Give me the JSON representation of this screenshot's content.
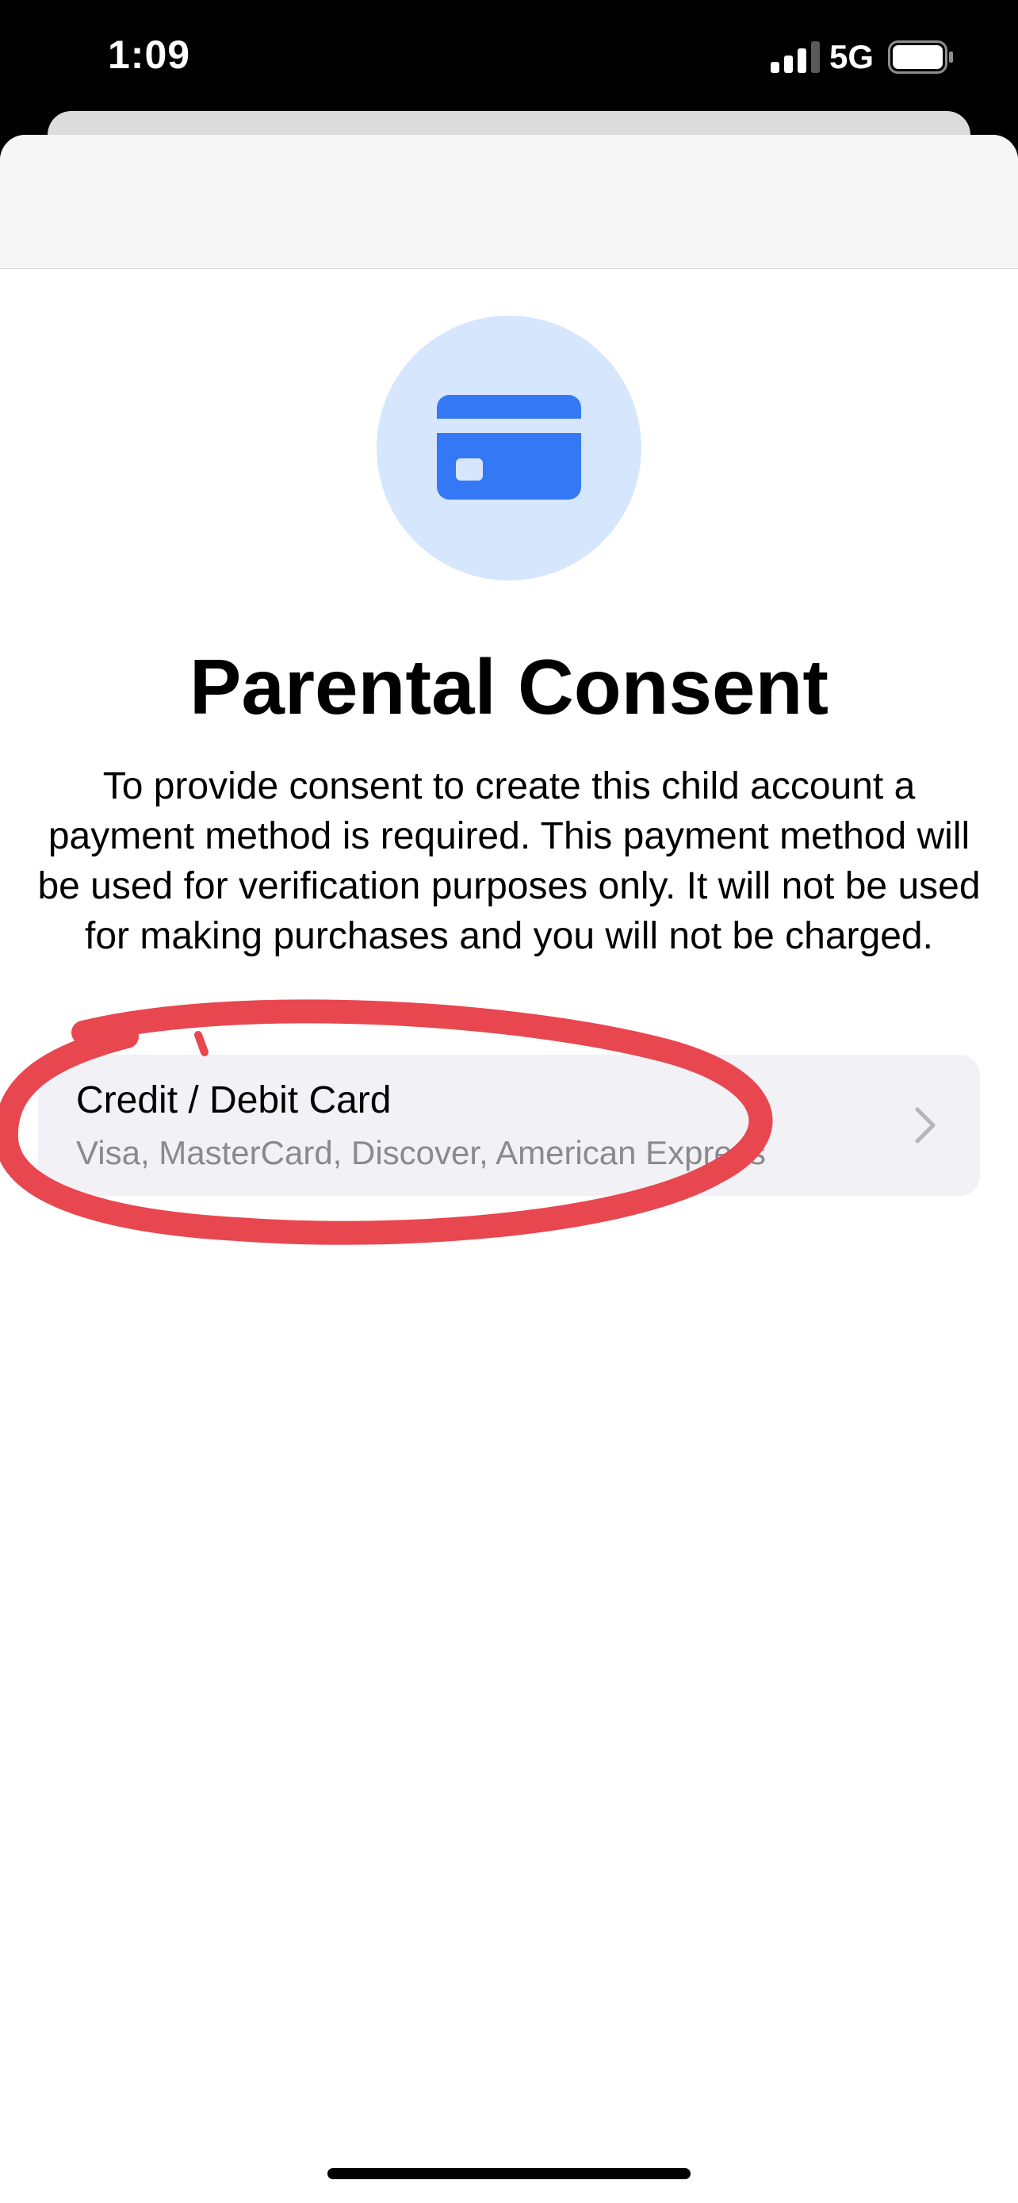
{
  "status_bar": {
    "time": "1:09",
    "network": "5G",
    "icons": [
      "signal-icon",
      "battery-icon"
    ]
  },
  "main": {
    "header_icon": "credit-card-icon",
    "title": "Parental Consent",
    "description": "To provide consent to create this child account a payment method is required. This payment method will be used for verification purposes only. It will not be used for making purchases and you will not be charged."
  },
  "payment_options": [
    {
      "title": "Credit / Debit Card",
      "subtitle": "Visa, MasterCard, Discover, American Express",
      "icon": "chevron-right-icon"
    }
  ],
  "annotation": {
    "type": "hand-drawn-circle",
    "color": "#e8474f"
  },
  "colors": {
    "accent": "#3478f6",
    "icon_background": "#d6e6fd",
    "option_background": "#f1f1f6",
    "secondary_text": "#8a8a8e"
  }
}
